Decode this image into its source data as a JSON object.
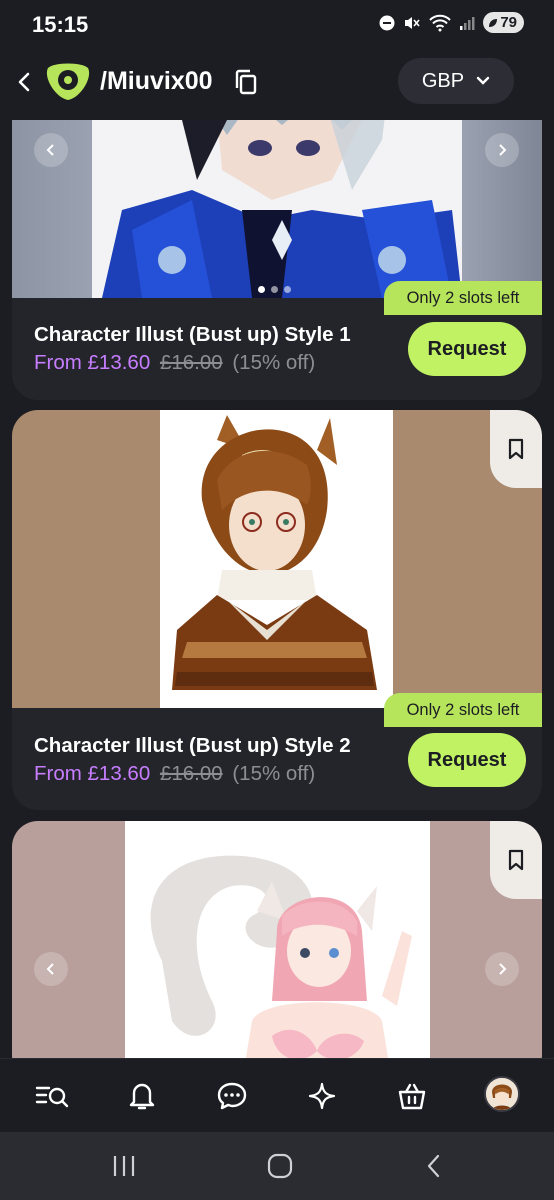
{
  "status_bar": {
    "time": "15:15",
    "battery": "79",
    "icons": [
      "do-not-disturb-icon",
      "mute-icon",
      "wifi-icon",
      "signal-icon",
      "battery-icon"
    ]
  },
  "header": {
    "profile_name": "/Miuvix00",
    "currency": "GBP",
    "icons": [
      "back-arrow-icon",
      "brand-logo",
      "copy-icon",
      "chevron-down-icon"
    ]
  },
  "listings": [
    {
      "title": "Character Illust (Bust up) Style 1",
      "price_from": "From £13.60",
      "price_old": "£16.00",
      "discount": "(15% off)",
      "slots": "Only 2 slots left",
      "request_label": "Request",
      "carousel_dots": 3,
      "active_dot": 1
    },
    {
      "title": "Character Illust (Bust up) Style 2",
      "price_from": "From £13.60",
      "price_old": "£16.00",
      "discount": "(15% off)",
      "slots": "Only 2 slots left",
      "request_label": "Request"
    },
    {
      "title": "",
      "bookmark": true
    }
  ],
  "bottom_nav": {
    "items": [
      "browse-icon",
      "notifications-icon",
      "messages-icon",
      "discover-icon",
      "shop-icon",
      "profile-avatar"
    ]
  },
  "system_nav": {
    "items": [
      "recent-apps-icon",
      "home-icon",
      "back-icon"
    ]
  },
  "colors": {
    "background": "#1c1d22",
    "card": "#24252b",
    "accent_green": "#c1f264",
    "price_purple": "#c77dff",
    "muted": "#8d8e93"
  }
}
